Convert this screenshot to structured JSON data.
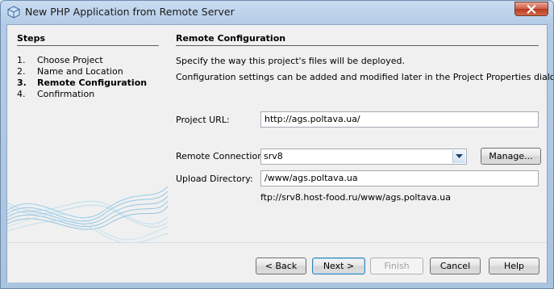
{
  "window": {
    "title": "New PHP Application from Remote Server"
  },
  "steps": {
    "title": "Steps",
    "items": [
      {
        "num": "1.",
        "label": "Choose Project",
        "current": false
      },
      {
        "num": "2.",
        "label": "Name and Location",
        "current": false
      },
      {
        "num": "3.",
        "label": "Remote Configuration",
        "current": true
      },
      {
        "num": "4.",
        "label": "Confirmation",
        "current": false
      }
    ]
  },
  "panel": {
    "title": "Remote Configuration",
    "desc1": "Specify the way this project's files will be deployed.",
    "desc2": "Configuration settings can be added and modified later in the Project Properties dialog box.",
    "project_url_label": "Project URL:",
    "project_url_value": "http://ags.poltava.ua/",
    "remote_connection_label": "Remote Connection:",
    "remote_connection_value": "srv8",
    "manage_label": "Manage...",
    "upload_dir_label": "Upload Directory:",
    "upload_dir_value": "/www/ags.poltava.ua",
    "ftp_path": "ftp://srv8.host-food.ru/www/ags.poltava.ua"
  },
  "buttons": {
    "back": "< Back",
    "next": "Next >",
    "finish": "Finish",
    "cancel": "Cancel",
    "help": "Help"
  },
  "icons": {
    "app": "netbeans-cube-icon",
    "close": "close-icon",
    "dropdown": "chevron-down-icon"
  }
}
